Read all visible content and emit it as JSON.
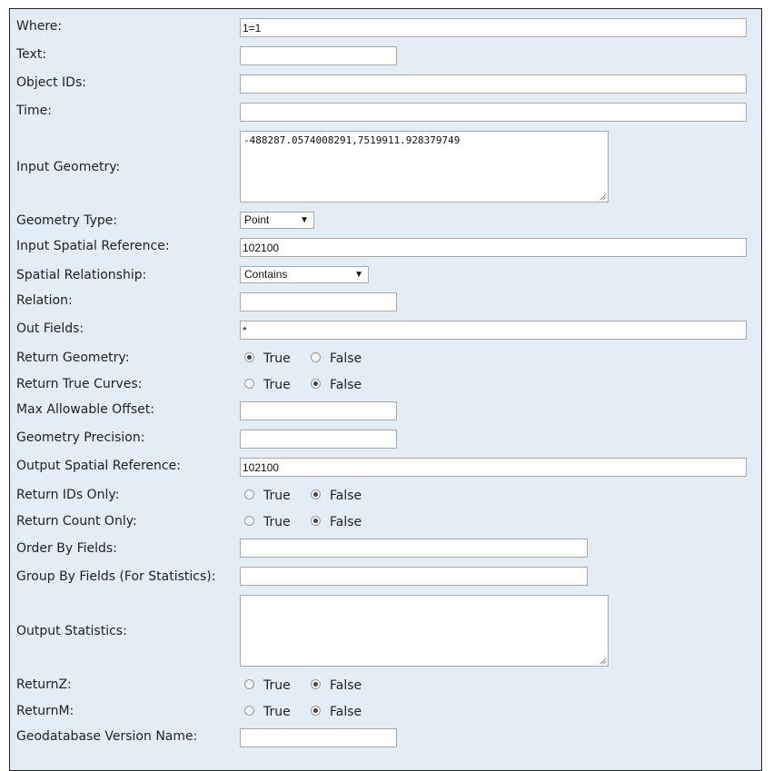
{
  "fields": {
    "where": {
      "label": "Where:",
      "value": "1=1"
    },
    "text": {
      "label": "Text:",
      "value": ""
    },
    "object_ids": {
      "label": "Object IDs:",
      "value": ""
    },
    "time": {
      "label": "Time:",
      "value": ""
    },
    "input_geometry": {
      "label": "Input Geometry:",
      "value": "-488287.0574008291,7519911.928379749"
    },
    "geometry_type": {
      "label": "Geometry Type:",
      "value": "Point"
    },
    "input_spatial_reference": {
      "label": "Input Spatial Reference:",
      "value": "102100"
    },
    "spatial_relationship": {
      "label": "Spatial Relationship:",
      "value": "Contains"
    },
    "relation": {
      "label": "Relation:",
      "value": ""
    },
    "out_fields": {
      "label": "Out Fields:",
      "value": "*"
    },
    "return_geometry": {
      "label": "Return Geometry:",
      "value": "True"
    },
    "return_true_curves": {
      "label": "Return True Curves:",
      "value": "False"
    },
    "max_allowable_offset": {
      "label": "Max Allowable Offset:",
      "value": ""
    },
    "geometry_precision": {
      "label": "Geometry Precision:",
      "value": ""
    },
    "output_spatial_reference": {
      "label": "Output Spatial Reference:",
      "value": "102100"
    },
    "return_ids_only": {
      "label": "Return IDs Only:",
      "value": "False"
    },
    "return_count_only": {
      "label": "Return Count Only:",
      "value": "False"
    },
    "order_by_fields": {
      "label": "Order By Fields:",
      "value": ""
    },
    "group_by_fields": {
      "label": "Group By Fields (For Statistics):",
      "value": ""
    },
    "output_statistics": {
      "label": "Output Statistics:",
      "value": ""
    },
    "return_z": {
      "label": "ReturnZ:",
      "value": "False"
    },
    "return_m": {
      "label": "ReturnM:",
      "value": "False"
    },
    "gdb_version": {
      "label": "Geodatabase Version Name:",
      "value": ""
    }
  },
  "radio_options": {
    "true_label": "True",
    "false_label": "False"
  }
}
